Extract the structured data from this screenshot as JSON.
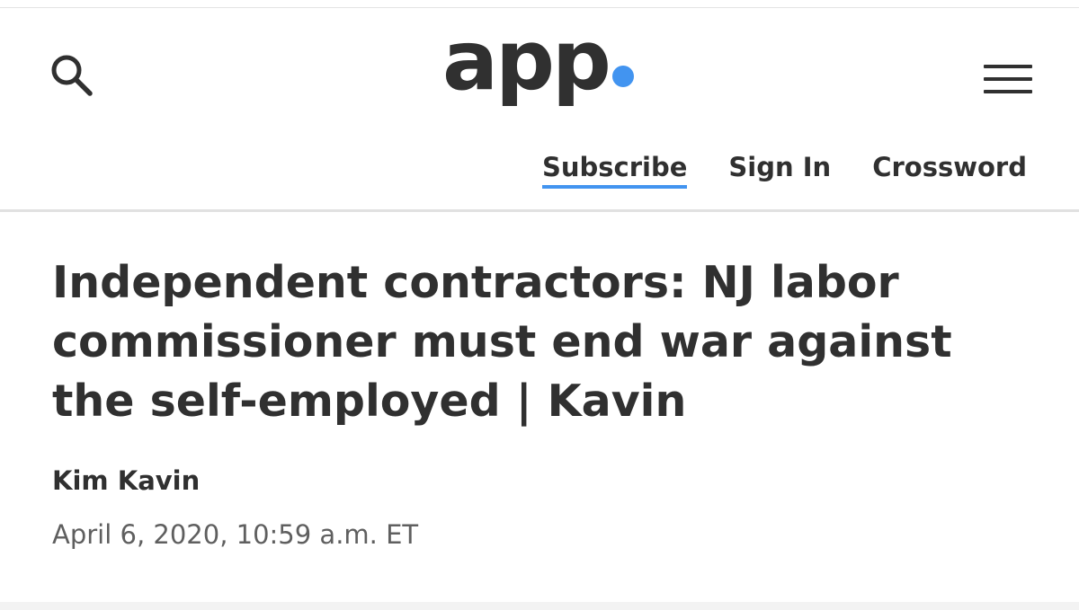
{
  "header": {
    "logo_text": "app",
    "brand_color": "#4294f0",
    "search_icon": "search-icon",
    "menu_icon": "hamburger-menu-icon"
  },
  "nav": {
    "items": [
      {
        "label": "Subscribe"
      },
      {
        "label": "Sign In"
      },
      {
        "label": "Crossword"
      }
    ]
  },
  "article": {
    "headline": "Independent contractors: NJ labor commissioner must end war against the self-employed | Kavin",
    "author": "Kim Kavin",
    "date": "April 6, 2020, 10:59 a.m. ET"
  }
}
